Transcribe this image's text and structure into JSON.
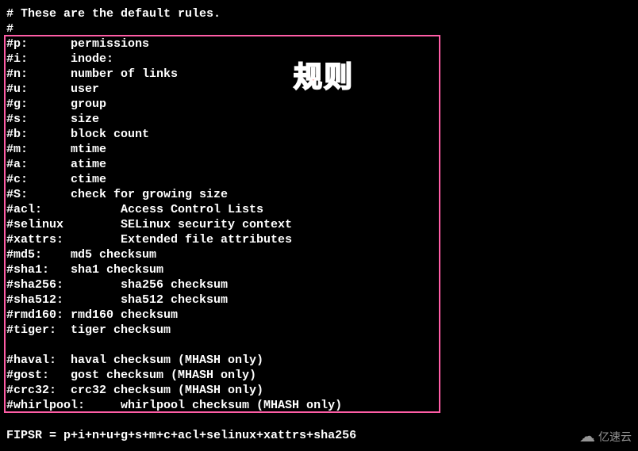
{
  "header": {
    "line1": "# These are the default rules.",
    "line2": "#"
  },
  "rules": [
    "#p:      permissions",
    "#i:      inode:",
    "#n:      number of links",
    "#u:      user",
    "#g:      group",
    "#s:      size",
    "#b:      block count",
    "#m:      mtime",
    "#a:      atime",
    "#c:      ctime",
    "#S:      check for growing size",
    "#acl:           Access Control Lists",
    "#selinux        SELinux security context",
    "#xattrs:        Extended file attributes",
    "#md5:    md5 checksum",
    "#sha1:   sha1 checksum",
    "#sha256:        sha256 checksum",
    "#sha512:        sha512 checksum",
    "#rmd160: rmd160 checksum",
    "#tiger:  tiger checksum",
    "",
    "#haval:  haval checksum (MHASH only)",
    "#gost:   gost checksum (MHASH only)",
    "#crc32:  crc32 checksum (MHASH only)",
    "#whirlpool:     whirlpool checksum (MHASH only)"
  ],
  "fipsr": "FIPSR = p+i+n+u+g+s+m+c+acl+selinux+xattrs+sha256",
  "annotation": "规则",
  "watermark": "亿速云"
}
